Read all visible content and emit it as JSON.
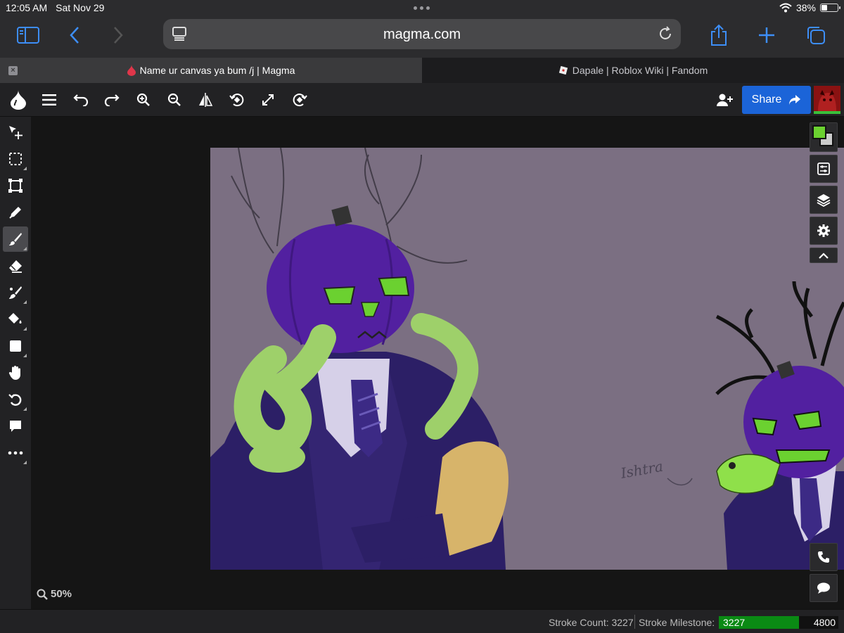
{
  "status": {
    "time": "12:05 AM",
    "date": "Sat Nov 29",
    "battery_percent": "38%",
    "battery_level": 0.38
  },
  "browser": {
    "url": "magma.com",
    "tabs": [
      {
        "title": "Name ur canvas ya bum /j | Magma",
        "active": true,
        "icon": "magma-drop-icon"
      },
      {
        "title": "Dapale | Roblox Wiki | Fandom",
        "active": false,
        "icon": "roblox-icon"
      }
    ]
  },
  "toolbar": {
    "share_label": "Share",
    "icons": [
      "magma-logo-icon",
      "menu-icon",
      "undo-icon",
      "redo-icon",
      "zoom-in-icon",
      "zoom-out-icon",
      "flip-icon",
      "rotate-left-icon",
      "fullscreen-icon",
      "rotate-right-icon",
      "add-user-icon",
      "share-arrow-icon"
    ]
  },
  "tools": [
    "move-tool",
    "selection-tool",
    "transform-tool",
    "pencil-tool",
    "brush-tool",
    "eraser-tool",
    "smudge-tool",
    "fill-tool",
    "shape-tool",
    "hand-tool",
    "rotate-view-tool",
    "comment-tool",
    "more-tools"
  ],
  "colors": {
    "primary": "#6bd130",
    "secondary": "#cccccc",
    "accent": "#1b64d8",
    "canvas_background": "#7b6f82"
  },
  "canvas": {
    "zoom": "50%",
    "annotation": "Ishtra"
  },
  "footer": {
    "stroke_count": "Stroke Count: 3227",
    "milestone_label": "Stroke Milestone:",
    "milestone_current": "3227",
    "milestone_target": "4800",
    "milestone_progress": 0.672
  }
}
